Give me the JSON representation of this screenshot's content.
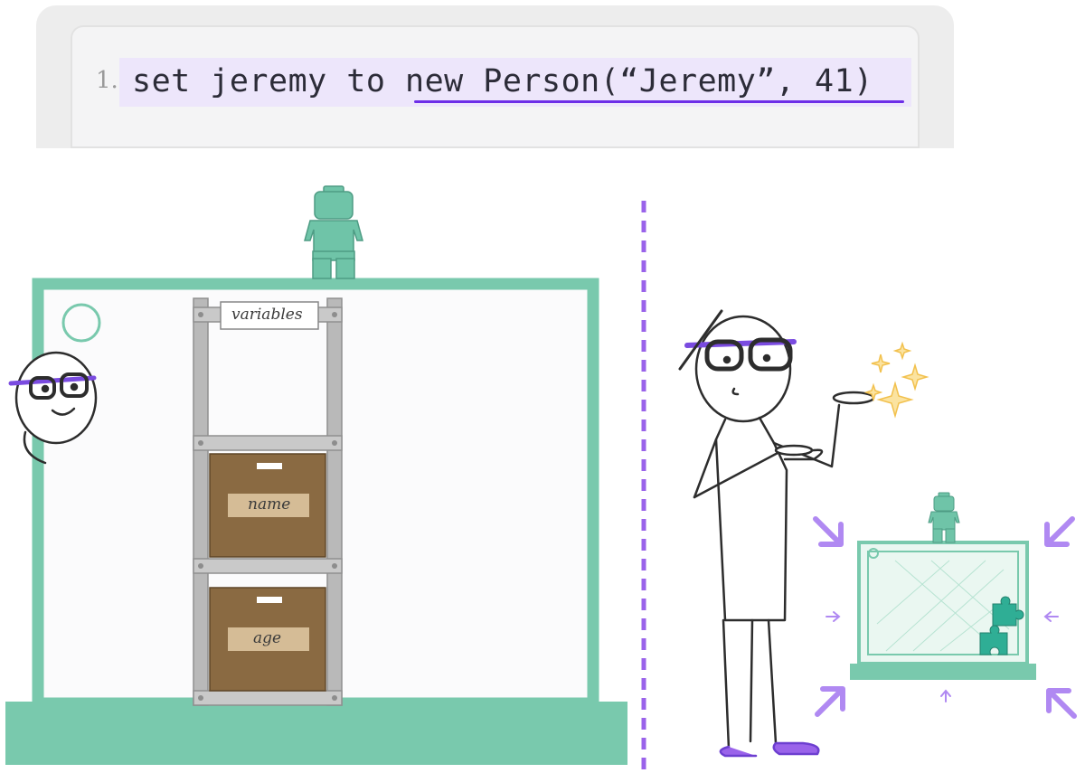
{
  "whiteboard": {
    "line_number": "1.",
    "code": "set jeremy to new Person(“Jeremy”, 41)"
  },
  "shelf": {
    "header_label": "variables",
    "boxes": [
      {
        "label": "name"
      },
      {
        "label": "age"
      }
    ]
  },
  "icons": {
    "figurine": "lego-figurine-icon",
    "puzzle": "puzzle-piece-icon",
    "sparkle": "sparkle-icon",
    "arrow": "inward-arrow-icon"
  },
  "colors": {
    "green": "#79c9ad",
    "purple": "#9a63ea",
    "box_brown": "#8a6a42",
    "shelf_gray": "#b9b9b9",
    "gold": "#f2c14e"
  }
}
